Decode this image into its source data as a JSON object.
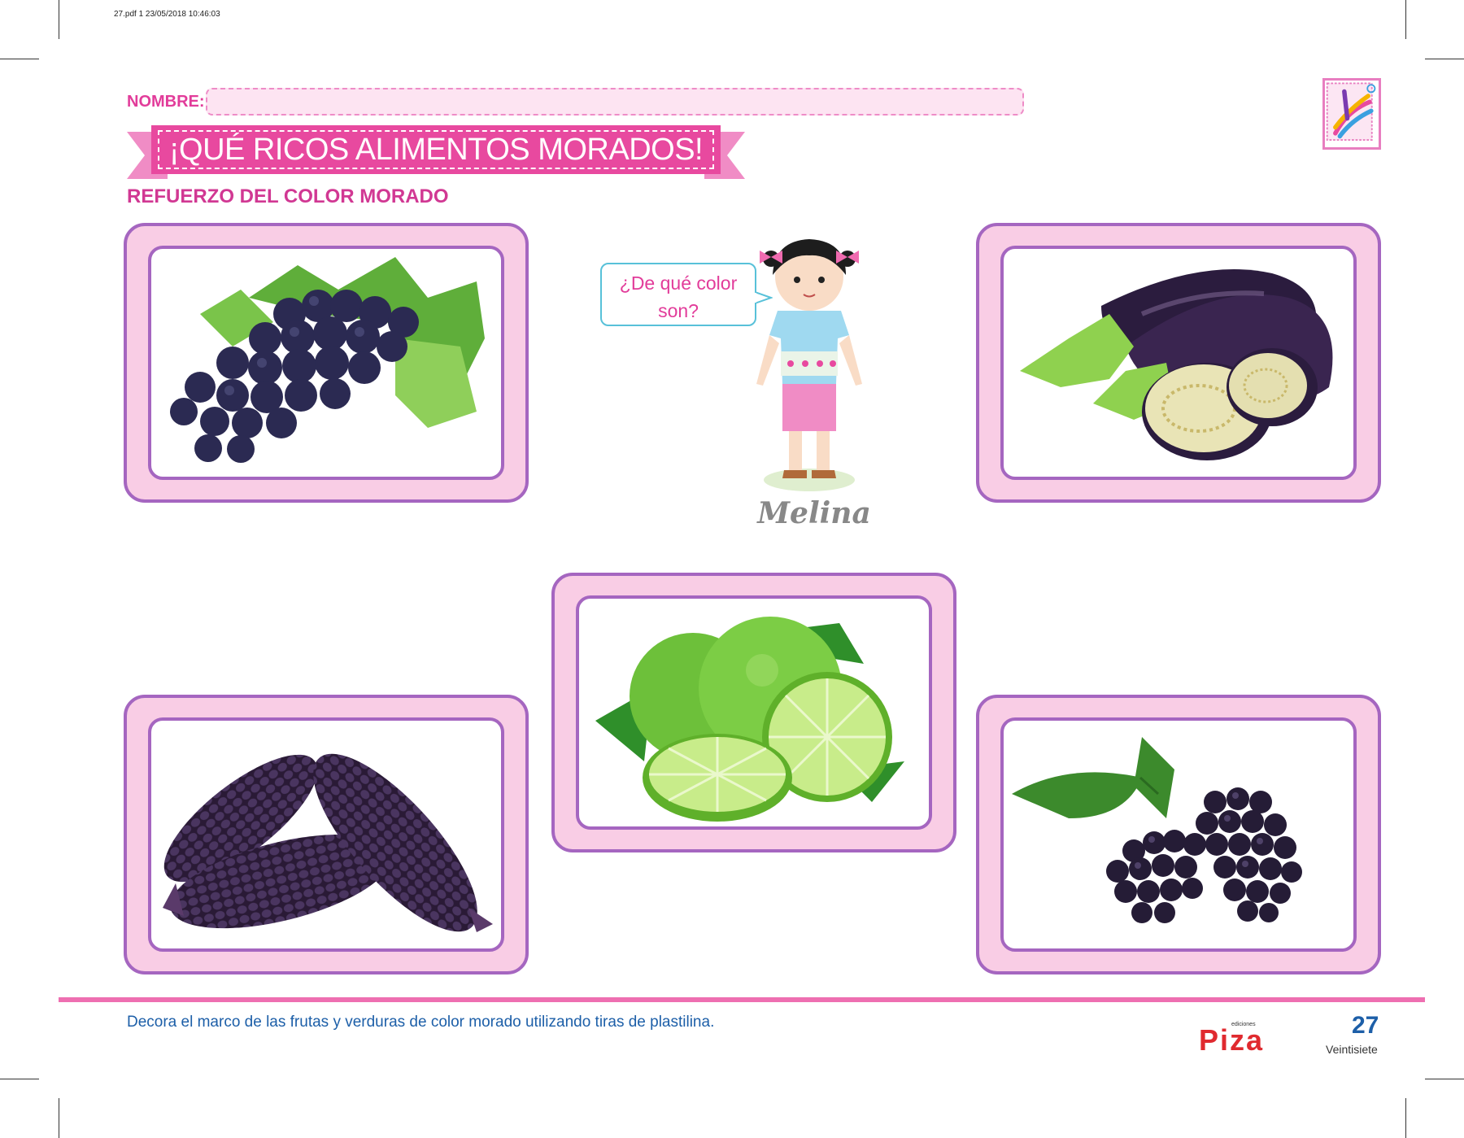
{
  "print_info": "27.pdf  1  23/05/2018  10:46:03",
  "header": {
    "name_label": "NOMBRE:",
    "title": "¡QUÉ RICOS ALIMENTOS MORADOS!",
    "subtitle": "REFUERZO DEL COLOR MORADO"
  },
  "character": {
    "speech": "¿De qué color son?",
    "name": "Melina"
  },
  "cards": [
    {
      "item": "grapes-icon"
    },
    {
      "item": "eggplant-icon"
    },
    {
      "item": "lime-icon"
    },
    {
      "item": "purple-corn-icon"
    },
    {
      "item": "blackberry-icon"
    }
  ],
  "footer": {
    "instruction": "Decora el marco de las frutas y verduras de color morado utilizando tiras de plastilina.",
    "brand": "Piza",
    "brand_small": "ediciones",
    "page_number": "27",
    "page_word": "Veintisiete"
  },
  "colors": {
    "accent_pink": "#e8499f",
    "frame_purple": "#a566c0",
    "frame_fill": "#f9cde5",
    "text_blue": "#1d5fa8"
  }
}
